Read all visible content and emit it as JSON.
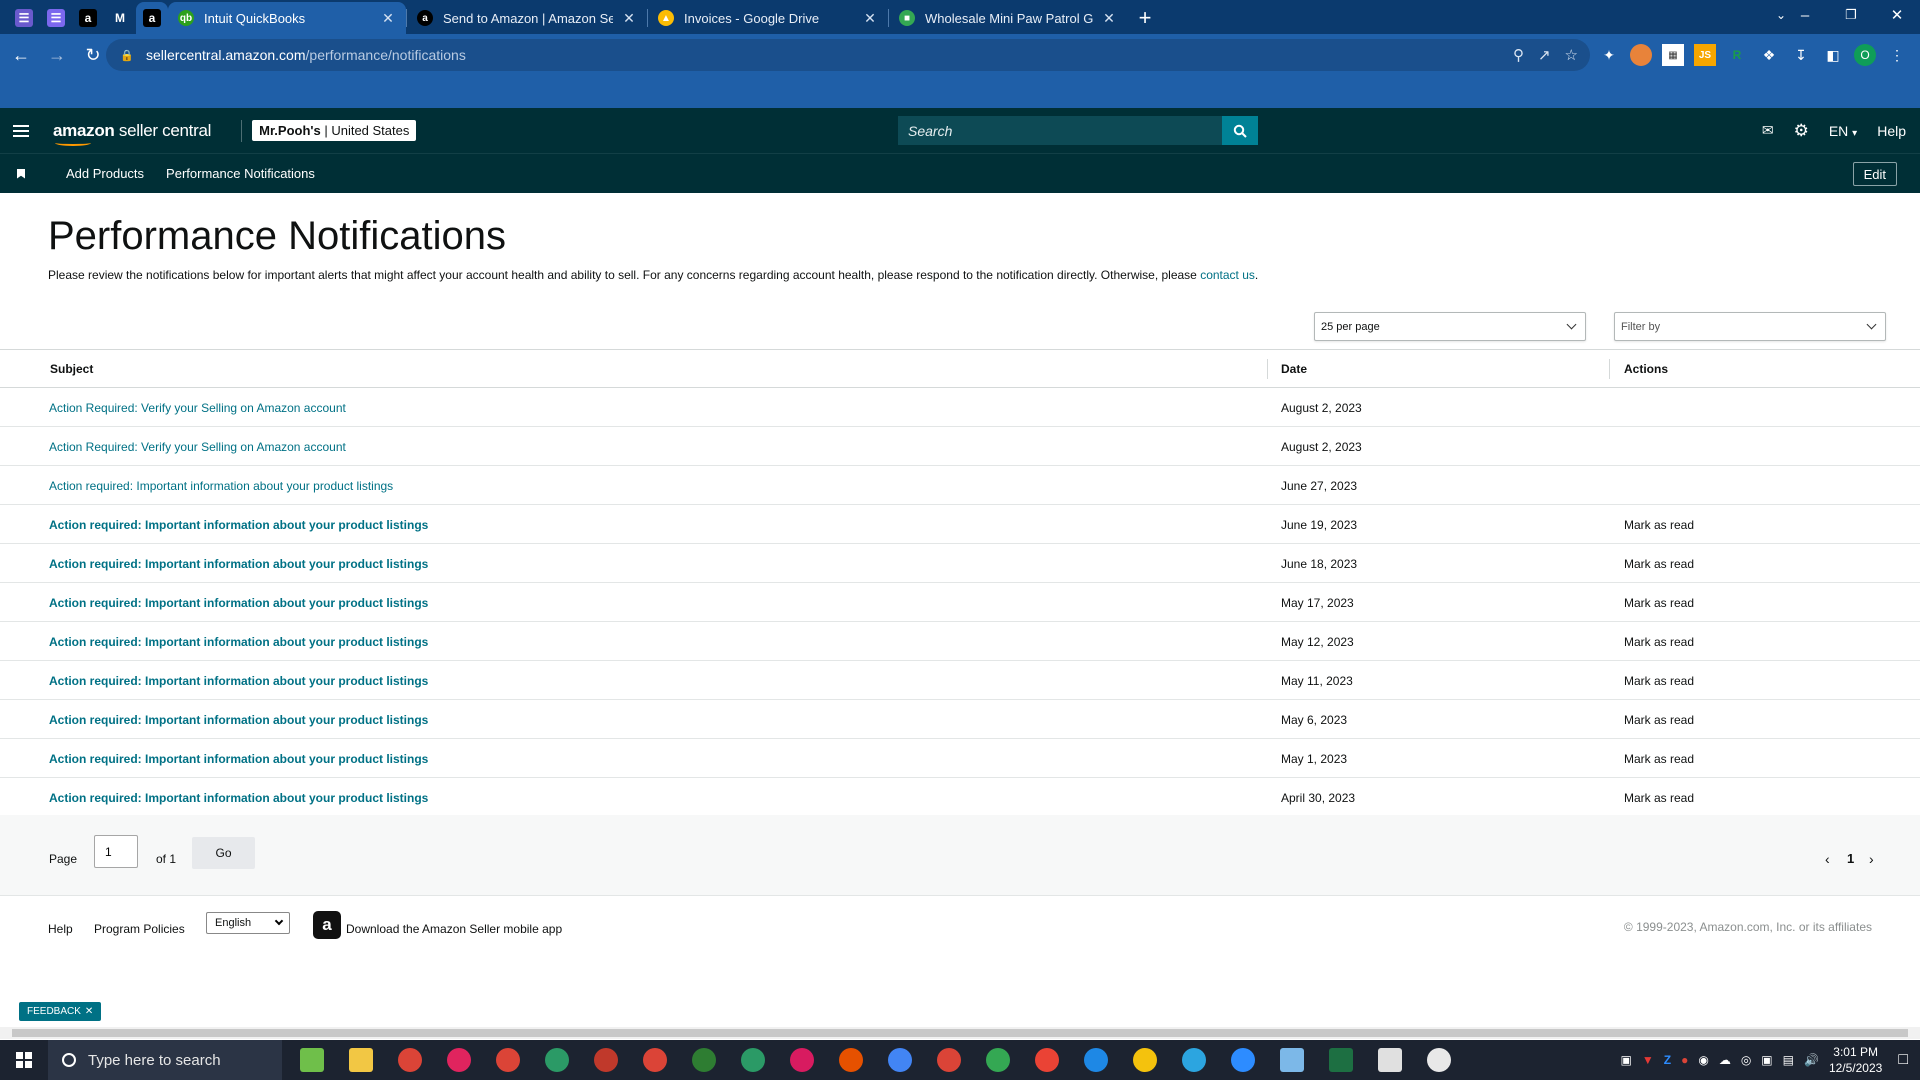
{
  "browser": {
    "pinned_tabs": [
      {
        "icon": "notes-icon",
        "color": "#6a5acd",
        "glyph": "☰"
      },
      {
        "icon": "notes-icon",
        "color": "#7b68ee",
        "glyph": "☰"
      },
      {
        "icon": "amazon-icon",
        "color": "#000000",
        "glyph": "a"
      },
      {
        "icon": "gmail-icon",
        "color": "#0b3a6e",
        "glyph": "M"
      },
      {
        "icon": "amazon-icon",
        "color": "#000000",
        "glyph": "a"
      }
    ],
    "tabs": [
      {
        "title": "Intuit QuickBooks",
        "icon": "quickbooks-icon",
        "color": "#2ca01c",
        "glyph": "qb",
        "active": true
      },
      {
        "title": "Send to Amazon | Amazon Seller",
        "icon": "amazon-icon",
        "color": "#000000",
        "glyph": "a",
        "active": false
      },
      {
        "title": "Invoices - Google Drive",
        "icon": "google-drive-icon",
        "color": "#fbbc04",
        "glyph": "▲",
        "active": false
      },
      {
        "title": "Wholesale Mini Paw Patrol Guita",
        "icon": "sheets-icon",
        "color": "#34a853",
        "glyph": "■",
        "active": false
      }
    ],
    "url_host": "sellercentral.amazon.com",
    "url_path": "/performance/notifications"
  },
  "header": {
    "logo_bold": "amazon",
    "logo_light": " seller central",
    "store_name": "Mr.Pooh's",
    "store_region": " | United States",
    "search_placeholder": "Search",
    "lang": "EN",
    "help": "Help"
  },
  "subnav": {
    "links": [
      "Add Products",
      "Performance Notifications"
    ],
    "edit": "Edit"
  },
  "page": {
    "title": "Performance Notifications",
    "description": "Please review the notifications below for important alerts that might affect your account health and ability to sell. For any concerns regarding account health, please respond to the notification directly. Otherwise, please ",
    "contact_link": "contact us",
    "description_end": ".",
    "per_page": "25 per page",
    "filter_placeholder": "Filter by"
  },
  "table": {
    "headers": {
      "subject": "Subject",
      "date": "Date",
      "actions": "Actions"
    },
    "rows": [
      {
        "subject": "Action Required: Verify your Selling on Amazon account",
        "date": "August 2, 2023",
        "action": "",
        "unread": false
      },
      {
        "subject": "Action Required: Verify your Selling on Amazon account",
        "date": "August 2, 2023",
        "action": "",
        "unread": false
      },
      {
        "subject": "Action required: Important information about your product listings",
        "date": "June 27, 2023",
        "action": "",
        "unread": false
      },
      {
        "subject": "Action required: Important information about your product listings",
        "date": "June 19, 2023",
        "action": "Mark as read",
        "unread": true
      },
      {
        "subject": "Action required: Important information about your product listings",
        "date": "June 18, 2023",
        "action": "Mark as read",
        "unread": true
      },
      {
        "subject": "Action required: Important information about your product listings",
        "date": "May 17, 2023",
        "action": "Mark as read",
        "unread": true
      },
      {
        "subject": "Action required: Important information about your product listings",
        "date": "May 12, 2023",
        "action": "Mark as read",
        "unread": true
      },
      {
        "subject": "Action required: Important information about your product listings",
        "date": "May 11, 2023",
        "action": "Mark as read",
        "unread": true
      },
      {
        "subject": "Action required: Important information about your product listings",
        "date": "May 6, 2023",
        "action": "Mark as read",
        "unread": true
      },
      {
        "subject": "Action required: Important information about your product listings",
        "date": "May 1, 2023",
        "action": "Mark as read",
        "unread": true
      },
      {
        "subject": "Action required: Important information about your product listings",
        "date": "April 30, 2023",
        "action": "Mark as read",
        "unread": true
      }
    ]
  },
  "pagination": {
    "label": "Page",
    "current": "1",
    "of": "of 1",
    "go": "Go",
    "page_number": "1"
  },
  "footer": {
    "help": "Help",
    "policies": "Program Policies",
    "language": "English",
    "app_text": "Download the Amazon Seller mobile app",
    "copyright": "© 1999-2023, Amazon.com, Inc. or its affiliates"
  },
  "feedback": "FEEDBACK",
  "taskbar": {
    "search_placeholder": "Type here to search",
    "time": "3:01 PM",
    "date": "12/5/2023",
    "apps": [
      {
        "icon": "gift-icon",
        "color": "#6fbf4a"
      },
      {
        "icon": "file-explorer-icon",
        "color": "#f2c744"
      },
      {
        "icon": "chrome-icon",
        "color": "#db4437"
      },
      {
        "icon": "chrome-icon",
        "color": "#e0245e"
      },
      {
        "icon": "chrome-icon",
        "color": "#db4437"
      },
      {
        "icon": "chrome-icon",
        "color": "#2b9a66"
      },
      {
        "icon": "chrome-icon",
        "color": "#c0392b"
      },
      {
        "icon": "chrome-icon",
        "color": "#db4437"
      },
      {
        "icon": "chrome-icon",
        "color": "#2e7d32"
      },
      {
        "icon": "chrome-icon",
        "color": "#2b9a66"
      },
      {
        "icon": "chrome-icon",
        "color": "#d81b60"
      },
      {
        "icon": "chrome-icon",
        "color": "#e65100"
      },
      {
        "icon": "chrome-icon",
        "color": "#4285f4"
      },
      {
        "icon": "chrome-icon",
        "color": "#db4437"
      },
      {
        "icon": "chrome-icon",
        "color": "#34a853"
      },
      {
        "icon": "chrome-icon",
        "color": "#ea4335"
      },
      {
        "icon": "chrome-icon",
        "color": "#1e88e5"
      },
      {
        "icon": "coin-icon",
        "color": "#f4c20d"
      },
      {
        "icon": "telegram-icon",
        "color": "#2ca5e0"
      },
      {
        "icon": "zoom-icon",
        "color": "#2d8cff"
      },
      {
        "icon": "notepad-icon",
        "color": "#7cb8e8"
      },
      {
        "icon": "excel-icon",
        "color": "#1d6f42"
      },
      {
        "icon": "calculator-icon",
        "color": "#e0e0e0"
      },
      {
        "icon": "paint-icon",
        "color": "#e8e8e8"
      }
    ]
  }
}
